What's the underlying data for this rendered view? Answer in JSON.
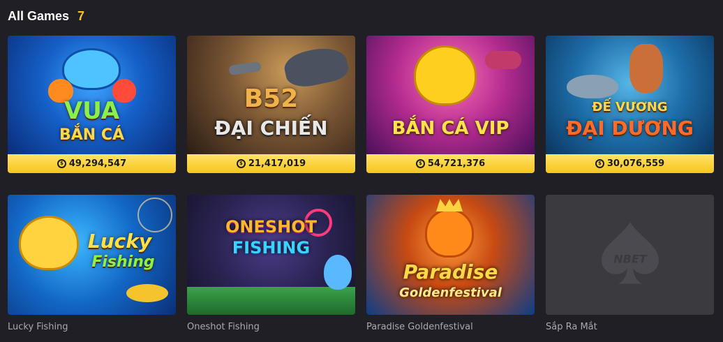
{
  "header": {
    "title": "All Games",
    "count": "7"
  },
  "colors": {
    "accent": "#f5c42c",
    "background": "#1f1f25",
    "jackpot": "#f7c51c"
  },
  "games_row1": [
    {
      "art_title_line1": "VUA",
      "art_title_line2": "BẮN CÁ",
      "jackpot": "49,294,547",
      "icon": "coin-icon"
    },
    {
      "art_title_line1": "B52",
      "art_title_line2": "ĐẠI CHIẾN",
      "jackpot": "21,417,019",
      "icon": "coin-icon"
    },
    {
      "art_title_line1": "",
      "art_title_line2": "BẮN CÁ VIP",
      "jackpot": "54,721,376",
      "icon": "coin-icon"
    },
    {
      "art_title_line1": "ĐẾ VƯƠNG",
      "art_title_line2": "ĐẠI DƯƠNG",
      "jackpot": "30,076,559",
      "icon": "coin-icon"
    }
  ],
  "games_row2": [
    {
      "name": "Lucky Fishing",
      "art_title_line1": "Lucky",
      "art_title_line2": "Fishing"
    },
    {
      "name": "Oneshot Fishing",
      "art_title_line1": "ONESHOT",
      "art_title_line2": "FISHING"
    },
    {
      "name": "Paradise Goldenfestival",
      "art_title_line1": "Paradise",
      "art_title_line2": "Goldenfestival"
    },
    {
      "name": "Sắp Ra Mắt",
      "logo_text": "NBET"
    }
  ]
}
